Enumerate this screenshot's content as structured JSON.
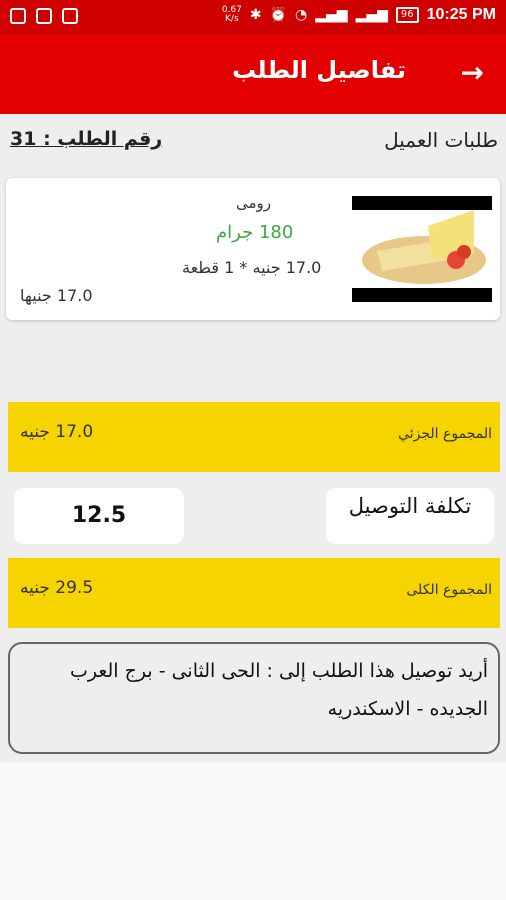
{
  "status_bar": {
    "net_speed": "0.67\nK/s",
    "battery": "96",
    "time": "10:25 PM"
  },
  "appbar": {
    "title": "تفاصيل الطلب",
    "back_icon": "arrow-right-icon"
  },
  "header": {
    "order_number": "رقم الطلب : 31",
    "section_title": "طلبات العميل"
  },
  "items": [
    {
      "name": "رومى",
      "weight": "180 جرام",
      "unit_line": "17.0 جنيه  * 1 قطعة",
      "total": "17.0 جنيها"
    }
  ],
  "summary": {
    "subtotal_label": "المجموع الجزئي",
    "subtotal_value": "17.0 جنيه",
    "delivery_label": "تكلفة التوصيل",
    "delivery_value": "12.5",
    "total_label": "المجموع الكلى",
    "total_value": "29.5 جنيه"
  },
  "address_text": "أريد توصيل هذا الطلب إلى  :  الحى الثانى - برج العرب الجديده - الاسكندريه",
  "colors": {
    "app_red": "#e20000",
    "status_red": "#cf0000",
    "summary_yellow": "#f6d400",
    "weight_green": "#3ca844"
  }
}
